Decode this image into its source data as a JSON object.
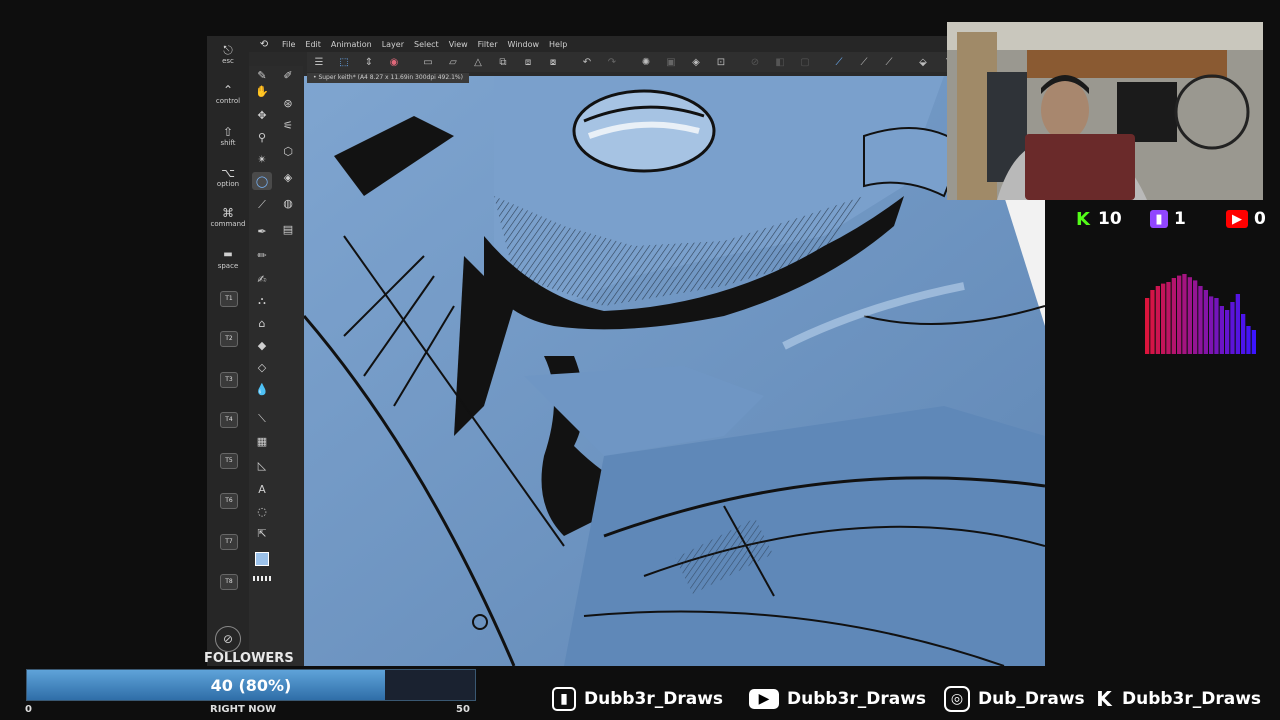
{
  "menu": {
    "items": [
      "File",
      "Edit",
      "Animation",
      "Layer",
      "Select",
      "View",
      "Filter",
      "Window",
      "Help"
    ]
  },
  "keys": {
    "esc": "esc",
    "control": "control",
    "shift": "shift",
    "option": "option",
    "command": "command",
    "space": "space",
    "t_keys": [
      "T1",
      "T2",
      "T3",
      "T4",
      "T5",
      "T6",
      "T7",
      "T8"
    ]
  },
  "document": {
    "tab": "• Super keith* (A4 8.27 x 11.69in 300dpi 492.1%)"
  },
  "stats": {
    "kick_count": "10",
    "twitch_count": "1",
    "youtube_count": "0",
    "colors": {
      "kick": "#53fc18",
      "twitch": "#9146ff",
      "youtube": "#ff0000"
    }
  },
  "followers": {
    "label": "FOLLOWERS",
    "progress_text": "40 (80%)",
    "progress_fraction": 0.8,
    "min": "0",
    "max": "50",
    "subtext": "RIGHT NOW",
    "bar_color": "#4f92cc"
  },
  "socials": [
    {
      "platform": "twitch",
      "handle": "Dubb3r_Draws"
    },
    {
      "platform": "youtube",
      "handle": "Dubb3r_Draws"
    },
    {
      "platform": "instagram",
      "handle": "Dub_Draws"
    },
    {
      "platform": "kick",
      "handle": "Dubb3r_Draws"
    }
  ],
  "icons": {
    "toolbar": [
      "menu-icon",
      "selection-icon",
      "arrows-icon",
      "color-wheel-icon",
      "new-file-icon",
      "open-icon",
      "save-icon",
      "save-as-icon",
      "export-icon",
      "undo-icon",
      "redo-icon",
      "loading-icon",
      "fill-icon",
      "transform-icon",
      "snap-icon",
      "ruler-icon"
    ]
  }
}
